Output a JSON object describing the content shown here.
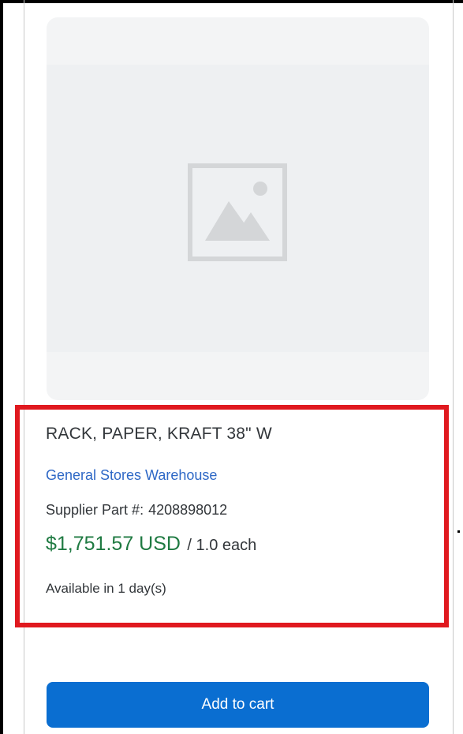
{
  "product": {
    "image_icon": "image-placeholder-icon",
    "title": "RACK, PAPER, KRAFT 38\" W",
    "supplier": "General Stores Warehouse",
    "part_label": "Supplier Part #:",
    "part_number": "4208898012",
    "price": "$1,751.57 USD",
    "per_unit": "/ 1.0 each",
    "availability": "Available in 1 day(s)"
  },
  "actions": {
    "add_to_cart_label": "Add to cart"
  },
  "colors": {
    "accent_blue": "#0a6ed1",
    "link_blue": "#2e68c6",
    "price_green": "#1f7a42",
    "highlight_red": "#e0191f",
    "image_bg": "#f3f4f5"
  }
}
